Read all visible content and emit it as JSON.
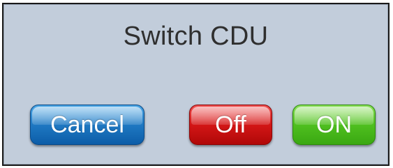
{
  "dialog": {
    "title": "Switch CDU",
    "buttons": {
      "cancel": "Cancel",
      "off": "Off",
      "on": "ON"
    }
  },
  "colors": {
    "panel_background": "#c2cddb",
    "cancel_button": "#1f78c2",
    "off_button": "#d31616",
    "on_button": "#4fbf1f"
  }
}
